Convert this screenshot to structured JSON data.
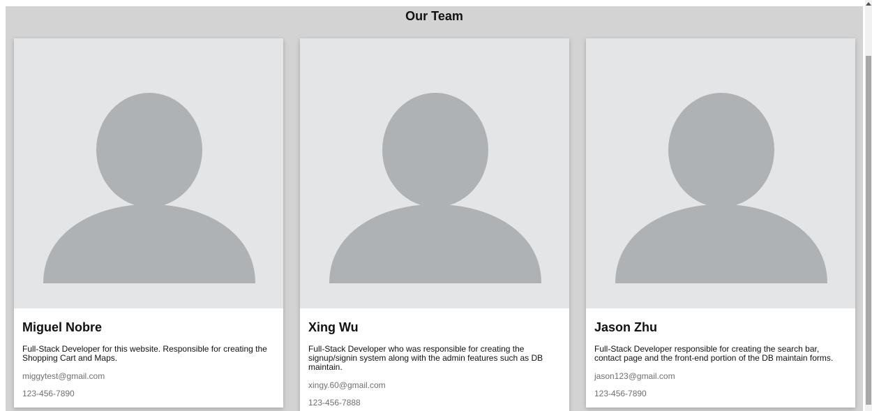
{
  "page": {
    "title": "Our Team"
  },
  "team": [
    {
      "name": "Miguel Nobre",
      "description": "Full-Stack Developer for this website. Responsible for creating the Shopping Cart and Maps.",
      "email": "miggytest@gmail.com",
      "phone": "123-456-7890",
      "avatar_icon": "person-placeholder-icon"
    },
    {
      "name": "Xing Wu",
      "description": "Full-Stack Developer who was responsible for creating the signup/signin system along with the admin features such as DB maintain.",
      "email": "xingy.60@gmail.com",
      "phone": "123-456-7888",
      "avatar_icon": "person-placeholder-icon"
    },
    {
      "name": "Jason Zhu",
      "description": "Full-Stack Developer responsible for creating the search bar, contact page and the front-end portion of the DB maintain forms.",
      "email": "jason123@gmail.com",
      "phone": "123-456-7890",
      "avatar_icon": "person-placeholder-icon"
    }
  ],
  "colors": {
    "page_background": "#d3d3d3",
    "avatar_background": "#e4e5e7",
    "avatar_figure": "#aeb2b5",
    "card_background": "#ffffff",
    "secondary_text": "#707070"
  },
  "scrollbar": {
    "up_icon": "scroll-up-arrow-icon"
  }
}
